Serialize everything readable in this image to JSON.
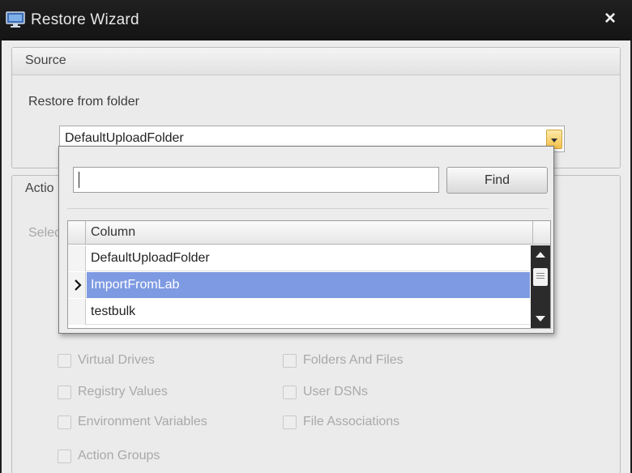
{
  "window": {
    "title": "Restore Wizard",
    "close_glyph": "×"
  },
  "source": {
    "header": "Source",
    "restore_label": "Restore from folder",
    "selected_folder": "DefaultUploadFolder"
  },
  "action": {
    "header": "Actio",
    "select_label": "Selec",
    "checkboxes": [
      {
        "label": "Virtual Drives",
        "checked": false
      },
      {
        "label": "Folders And Files",
        "checked": false
      },
      {
        "label": "Registry Values",
        "checked": false
      },
      {
        "label": "User DSNs",
        "checked": false
      },
      {
        "label": "Environment Variables",
        "checked": false
      },
      {
        "label": "File Associations",
        "checked": false
      },
      {
        "label": "Action Groups",
        "checked": false
      }
    ]
  },
  "dropdown": {
    "search_value": "",
    "find_label": "Find",
    "column_header": "Column",
    "rows": [
      {
        "label": "DefaultUploadFolder",
        "selected": false
      },
      {
        "label": "ImportFromLab",
        "selected": true
      },
      {
        "label": "testbulk",
        "selected": false
      }
    ]
  },
  "colors": {
    "selection": "#7e9ae2",
    "combo_arrow": "#f4c24a",
    "titlebar": "#1a1a1a"
  }
}
